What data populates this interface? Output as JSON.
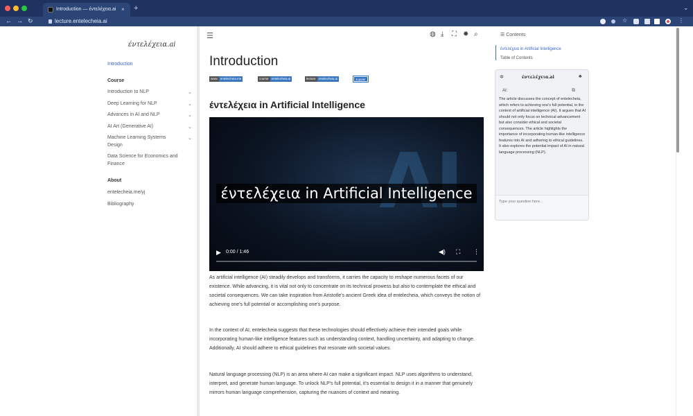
{
  "browser": {
    "tab_title": "Introduction — έντελέχεια.ai",
    "tab_close": "×",
    "new_tab": "+",
    "url": "lecture.entelecheia.ai",
    "colors": {
      "chrome": "#1f3260",
      "address": "#2b4576"
    }
  },
  "sidebar": {
    "logo": "έντελέχεια.ai",
    "intro": "Introduction",
    "course_heading": "Course",
    "course_items": [
      "Introduction to NLP",
      "Deep Learning for NLP",
      "Advances in AI and NLP",
      "AI Art (Generative AI)",
      "Machine Learning Systems",
      "Design",
      "Data Science for Economics and",
      "Finance"
    ],
    "about_heading": "About",
    "about_items": [
      "entelecheia.me/yj",
      "Bibliography"
    ]
  },
  "main": {
    "page_title": "Introduction",
    "badges": [
      {
        "l": "www",
        "r": "entelecheia.me"
      },
      {
        "l": "course",
        "r": "entelecheia.ai"
      },
      {
        "l": "lecture",
        "r": "entelecheia.ai"
      }
    ],
    "badge_blue": "Jupyter",
    "section_title": "έντελέχεια in Artificial Intelligence",
    "video": {
      "caption": "έντελέχεια in Artificial Intelligence",
      "background_text": "AI",
      "time": "0:00 / 1:46",
      "progress_fraction": 0.0
    },
    "paragraphs": [
      "As artificial intelligence (AI) steadily develops and transforms, it carries the capacity to reshape numerous facets of our existence. While advancing, it is vital not only to concentrate on its technical prowess but also to contemplate the ethical and societal consequences. We can take inspiration from Aristotle's ancient Greek idea of entelecheia, which conveys the notion of achieving one's full potential or accomplishing one's purpose.",
      "In the context of AI, entelecheia suggests that these technologies should effectively achieve their intended goals while incorporating human-like intelligence features such as understanding context, handling uncertainty, and adapting to change. Additionally, AI should adhere to ethical guidelines that resonate with societal values.",
      "Natural language processing (NLP) is an area where AI can make a significant impact. NLP uses algorithms to understand, interpret, and generate human language. To unlock NLP's full potential, it's essential to design it in a manner that genuinely mirrors human language comprehension, capturing the nuances of context and meaning."
    ]
  },
  "toc": {
    "heading": "Contents",
    "items": [
      "έντελέχεια in Artificial Intelligence",
      "Table of Contents"
    ]
  },
  "chat": {
    "title": "έντελέχεια.ai",
    "ai_label": "AI:",
    "message": "The article discusses the concept of entelecheia, which refers to achieving one's full potential, in the context of artificial intelligence (AI). It argues that AI should not only focus on technical advancement but also consider ethical and societal consequences. The article highlights the importance of incorporating human-like intelligence features into AI and adhering to ethical guidelines. It also explores the potential impact of AI in natural language processing (NLP).",
    "placeholder": "Type your question here..."
  }
}
